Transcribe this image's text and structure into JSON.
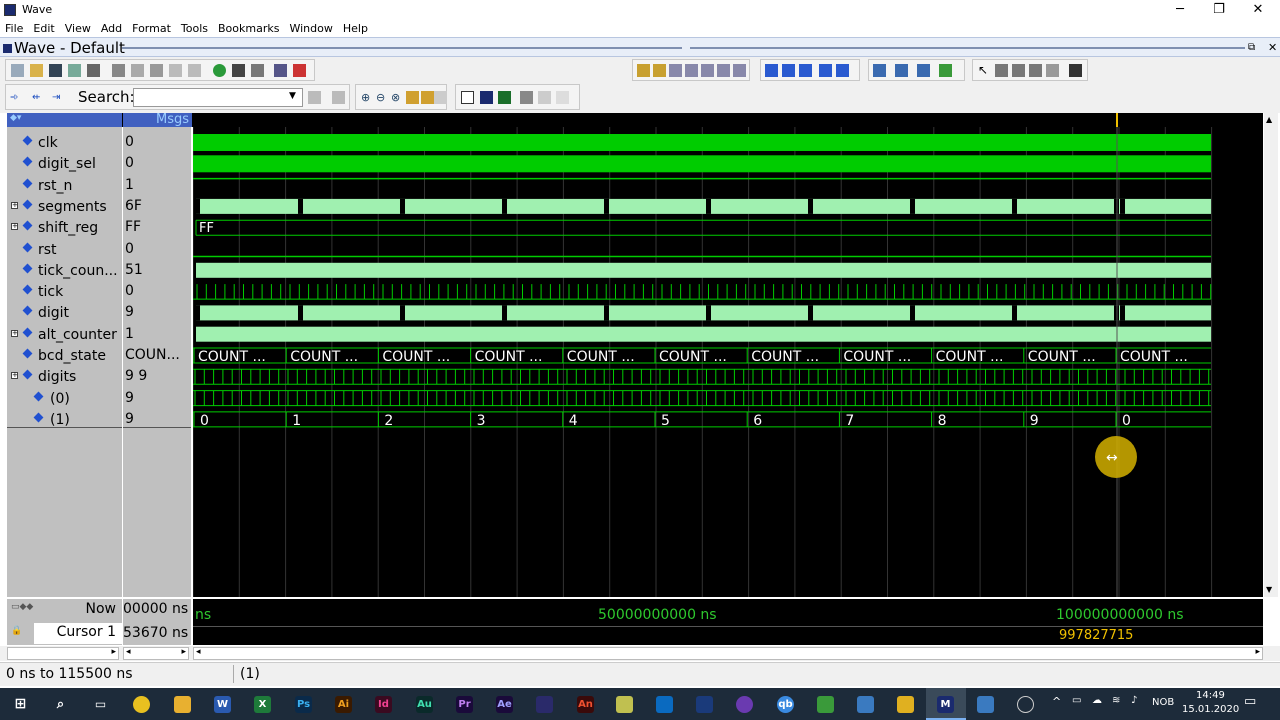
{
  "window": {
    "title": "Wave"
  },
  "menu": [
    "File",
    "Edit",
    "View",
    "Add",
    "Format",
    "Tools",
    "Bookmarks",
    "Window",
    "Help"
  ],
  "pane": {
    "title": "Wave - Default"
  },
  "toolbar": {
    "search_label": "Search:",
    "search_value": ""
  },
  "header": {
    "msgs": "Msgs"
  },
  "signals": [
    {
      "name": "clk",
      "value": "0",
      "expandable": false,
      "indent": false
    },
    {
      "name": "digit_sel",
      "value": "0",
      "expandable": false,
      "indent": false
    },
    {
      "name": "rst_n",
      "value": "1",
      "expandable": false,
      "indent": false
    },
    {
      "name": "segments",
      "value": "6F",
      "expandable": true,
      "indent": false
    },
    {
      "name": "shift_reg",
      "value": "FF",
      "expandable": true,
      "indent": false
    },
    {
      "name": "rst",
      "value": "0",
      "expandable": false,
      "indent": false
    },
    {
      "name": "tick_coun...",
      "value": "51",
      "expandable": false,
      "indent": false
    },
    {
      "name": "tick",
      "value": "0",
      "expandable": false,
      "indent": false
    },
    {
      "name": "digit",
      "value": "9",
      "expandable": false,
      "indent": false
    },
    {
      "name": "alt_counter",
      "value": "1",
      "expandable": true,
      "indent": false
    },
    {
      "name": "bcd_state",
      "value": "COUN...",
      "expandable": false,
      "indent": false
    },
    {
      "name": "digits",
      "value": "9 9",
      "expandable": true,
      "indent": false
    },
    {
      "name": "(0)",
      "value": "9",
      "expandable": false,
      "indent": true
    },
    {
      "name": "(1)",
      "value": "9",
      "expandable": false,
      "indent": true
    }
  ],
  "wave_labels": {
    "shift_reg": "FF",
    "bcd_state": [
      "COUNT ...",
      "COUNT ...",
      "COUNT ...",
      "COUNT ...",
      "COUNT ...",
      "COUNT ...",
      "COUNT ...",
      "COUNT ...",
      "COUNT ...",
      "COUNT ...",
      "COUNT ..."
    ],
    "digits_1": [
      "0",
      "1",
      "2",
      "3",
      "4",
      "5",
      "6",
      "7",
      "8",
      "9",
      "0"
    ]
  },
  "now": {
    "label": "Now",
    "value": "00000 ns"
  },
  "cursor": {
    "label": "Cursor 1",
    "value": "53670 ns",
    "readout": "997827715"
  },
  "timeline": {
    "t0": "ns",
    "t1": "50000000000 ns",
    "t2": "100000000000 ns"
  },
  "status": {
    "range": "0 ns to 115500 ns",
    "selection": "(1)"
  },
  "taskbar": {
    "time": "14:49",
    "date": "15.01.2020",
    "lang": "NOB"
  },
  "colors": {
    "wave_green": "#00cc00",
    "bus_fill": "#a0f0b0",
    "cursor": "#f0c000"
  }
}
